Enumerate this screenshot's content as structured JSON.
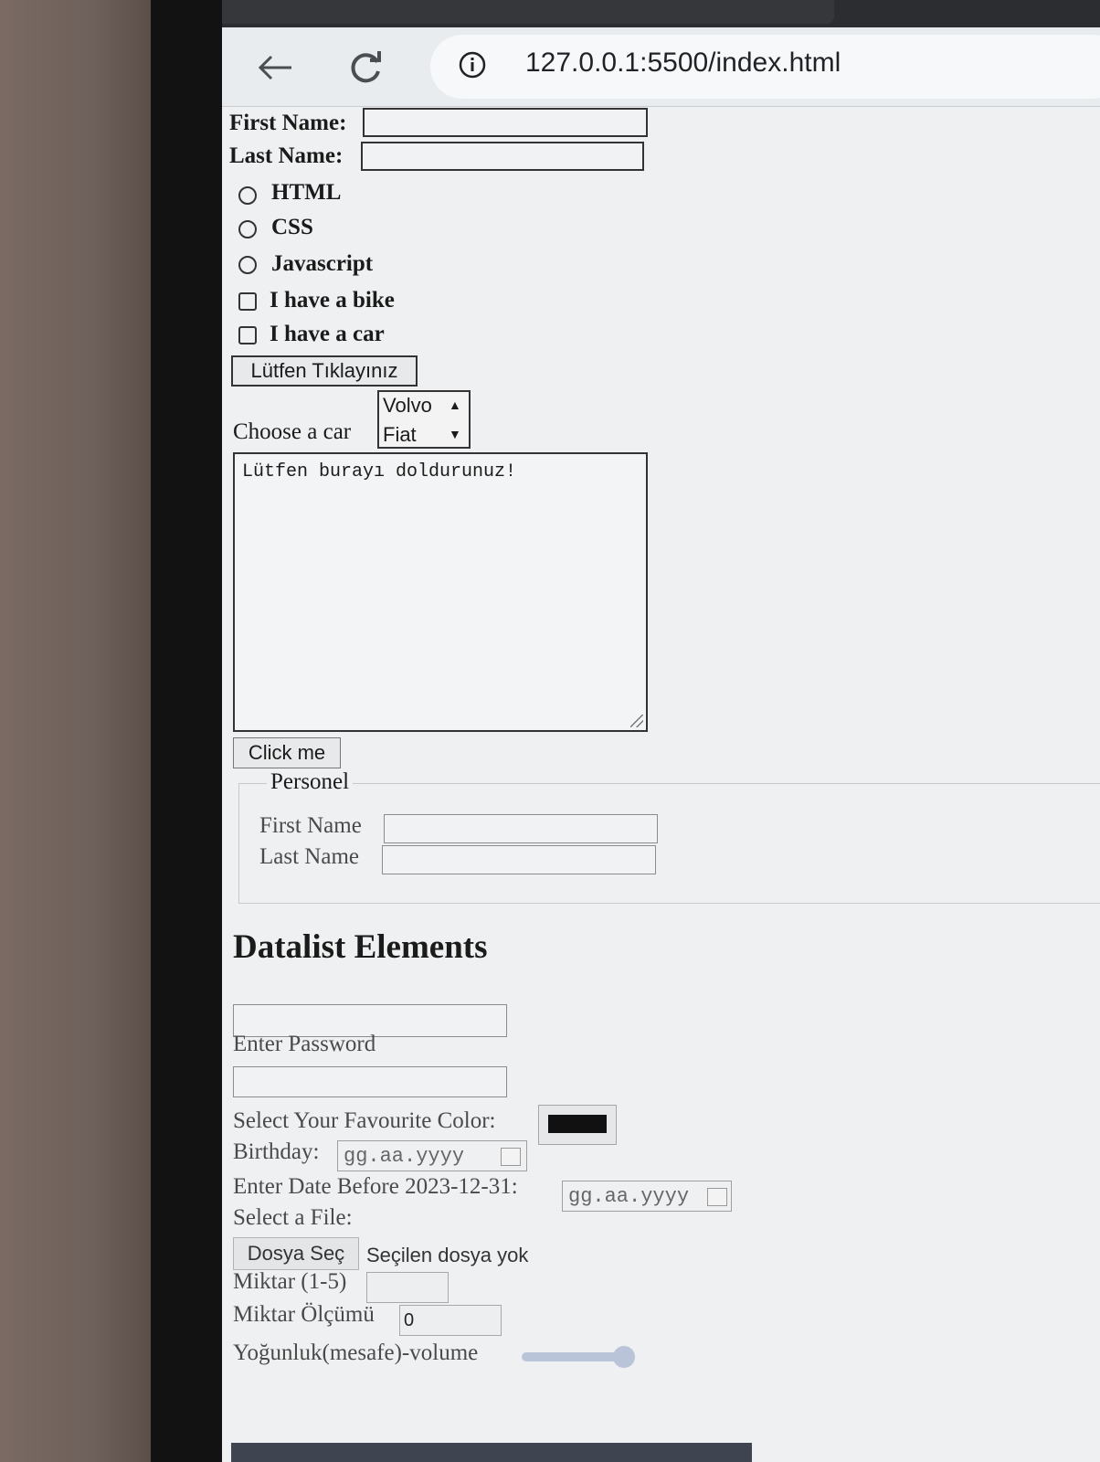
{
  "browser": {
    "url": "127.0.0.1:5500/index.html",
    "icons": [
      "back-arrow-icon",
      "reload-icon",
      "info-icon"
    ]
  },
  "form": {
    "first_name_label": "First Name:",
    "last_name_label": "Last Name:",
    "first_name_value": "",
    "last_name_value": "",
    "radios": [
      "HTML",
      "CSS",
      "Javascript"
    ],
    "checkboxes": [
      "I have a bike",
      "I have a car"
    ],
    "submit_button": "Lütfen Tıklayınız",
    "car_label": "Choose a car",
    "car_options": [
      "Volvo",
      "Fiat"
    ],
    "textarea_value": "Lütfen burayı doldurunuz!",
    "click_button": "Click me"
  },
  "fieldset": {
    "legend": "Personel",
    "first_name_label": "First Name",
    "last_name_label": "Last Name"
  },
  "datalist": {
    "heading": "Datalist Elements",
    "password_label": "Enter Password",
    "color_label": "Select Your Favourite Color:",
    "color_value": "#111111",
    "birthday_label": "Birthday:",
    "date_placeholder": "gg.aa.yyyy",
    "date_before_label": "Enter Date Before 2023-12-31:",
    "file_label": "Select a File:",
    "file_button": "Dosya Seç",
    "file_status": "Seçilen dosya yok",
    "quantity_label": "Miktar (1-5)",
    "measure_label": "Miktar Ölçümü",
    "measure_value": "0",
    "volume_label": "Yoğunluk(mesafe)-volume",
    "volume_value": 1.0
  }
}
